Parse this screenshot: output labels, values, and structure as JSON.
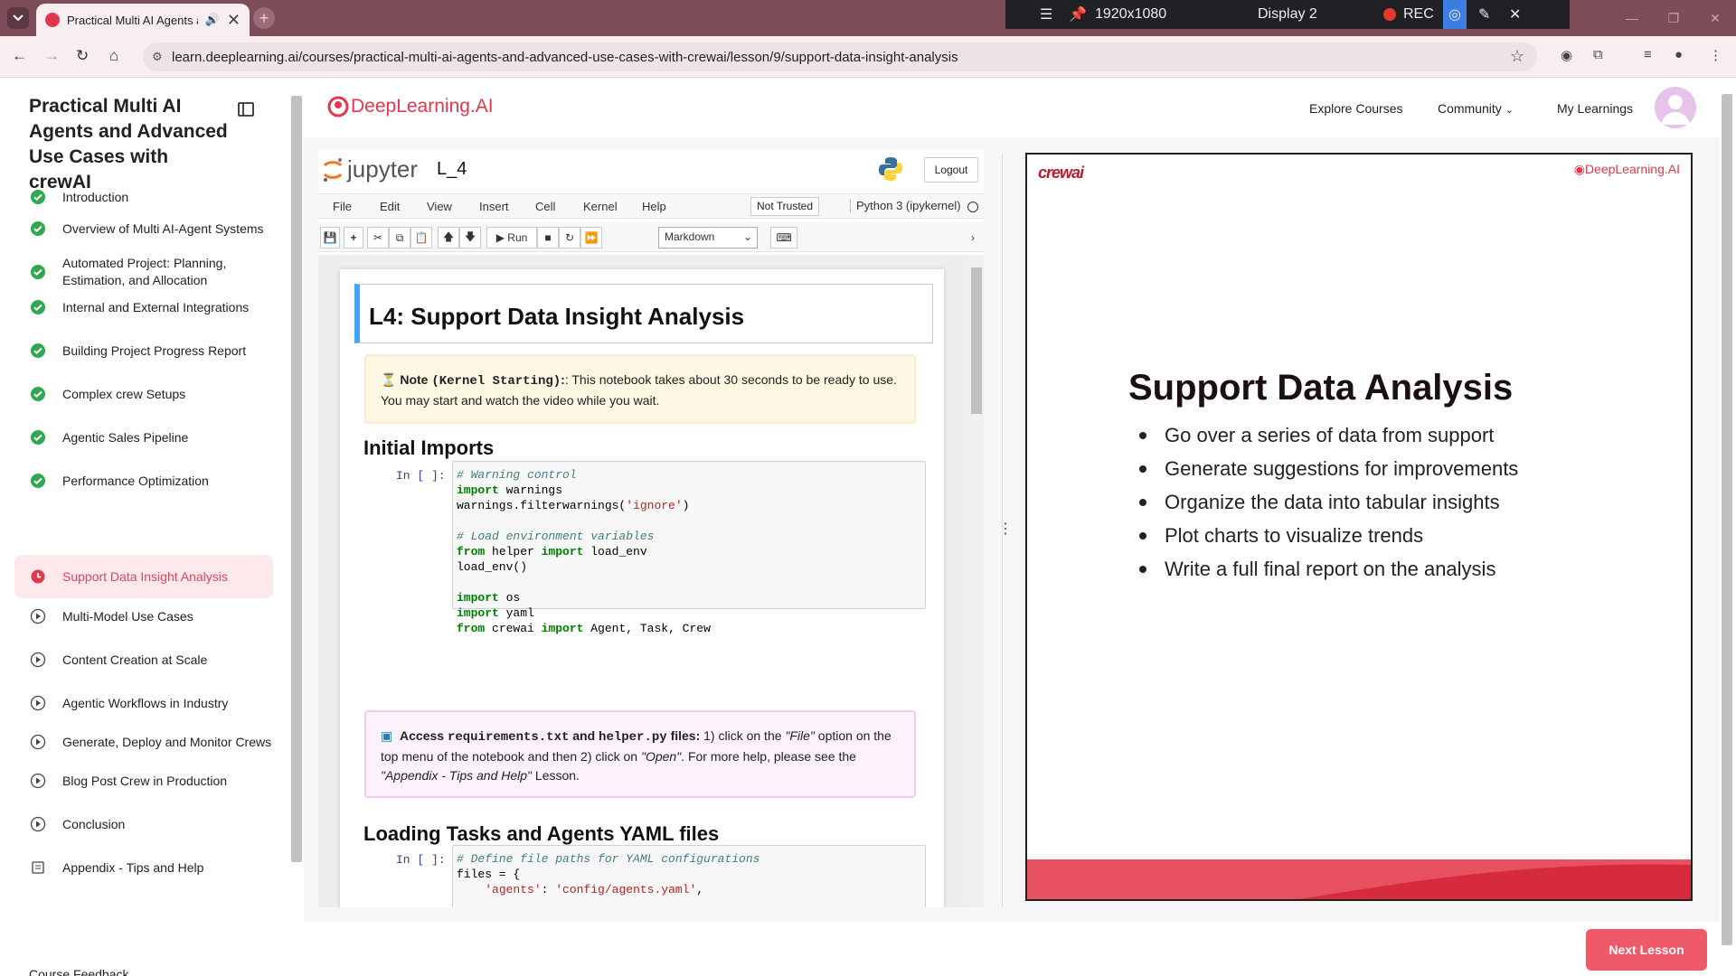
{
  "browser": {
    "tab_title": "Practical Multi AI Agents and Advanced Use Cases with crewAI",
    "url": "learn.deeplearning.ai/courses/practical-multi-ai-agents-and-advanced-use-cases-with-crewai/lesson/9/support-data-insight-analysis"
  },
  "recorder": {
    "resolution": "1920x1080",
    "display": "Display 2",
    "rec_label": "REC"
  },
  "sidebar": {
    "course_title": "Practical Multi AI Agents and Advanced Use Cases with crewAI",
    "lessons": [
      {
        "label": "Introduction",
        "status": "done"
      },
      {
        "label": "Overview of Multi AI-Agent Systems",
        "status": "done"
      },
      {
        "label": "Automated Project: Planning, Estimation, and Allocation",
        "status": "done"
      },
      {
        "label": "Internal and External Integrations",
        "status": "done"
      },
      {
        "label": "Building Project Progress Report",
        "status": "done"
      },
      {
        "label": "Complex crew Setups",
        "status": "done"
      },
      {
        "label": "Agentic Sales Pipeline",
        "status": "done"
      },
      {
        "label": "Performance Optimization",
        "status": "done"
      },
      {
        "label": "Support Data Insight Analysis",
        "status": "active"
      },
      {
        "label": "Multi-Model Use Cases",
        "status": "todo"
      },
      {
        "label": "Content Creation at Scale",
        "status": "todo"
      },
      {
        "label": "Agentic Workflows in Industry",
        "status": "todo"
      },
      {
        "label": "Generate, Deploy and Monitor Crews",
        "status": "todo"
      },
      {
        "label": "Blog Post Crew in Production",
        "status": "todo"
      },
      {
        "label": "Conclusion",
        "status": "todo"
      },
      {
        "label": "Appendix - Tips and Help",
        "status": "reading"
      }
    ],
    "feedback": "Course Feedback"
  },
  "topnav": {
    "logo": "DeepLearning.AI",
    "explore": "Explore Courses",
    "community": "Community",
    "my_learnings": "My Learnings"
  },
  "jupyter": {
    "brand": "jupyter",
    "notebook_name": "L_4",
    "logout": "Logout",
    "menu": [
      "File",
      "Edit",
      "View",
      "Insert",
      "Cell",
      "Kernel",
      "Help"
    ],
    "trusted": "Not Trusted",
    "kernel": "Python 3 (ipykernel)",
    "run": "Run",
    "cell_type": "Markdown",
    "h1": "L4: Support Data Insight Analysis",
    "note": {
      "icon": "⏳",
      "bold": "Note",
      "mono": "(Kernel Starting)",
      "text1": ": This notebook takes about 30 seconds to be ready to use. You may start and watch the video while you wait."
    },
    "h2_imports": "Initial Imports",
    "prompt": "In [ ]:",
    "code1": [
      "# Warning control",
      "import warnings",
      "warnings.filterwarnings('ignore')",
      "",
      "# Load environment variables",
      "from helper import load_env",
      "load_env()",
      "",
      "import os",
      "import yaml",
      "from crewai import Agent, Task, Crew"
    ],
    "access": {
      "lead": "Access",
      "file1": "requirements.txt",
      "and": "and",
      "file2": "helper.py",
      "files": "files:",
      "t1": " 1) click on the ",
      "file_opt": "\"File\"",
      "t2": " option on the top menu of the notebook and then 2) click on ",
      "open": "\"Open\"",
      "t3": ". For more help, please see the ",
      "appendix": "\"Appendix - Tips and Help\"",
      "t4": " Lesson."
    },
    "h2_yaml": "Loading Tasks and Agents YAML files",
    "code2": [
      "# Define file paths for YAML configurations",
      "files = {",
      "    'agents': 'config/agents.yaml',"
    ]
  },
  "slide": {
    "crew_logo": "crewai",
    "dl_logo": "DeepLearning.AI",
    "title": "Support Data Analysis",
    "bullets": [
      "Go over a series of data from support",
      "Generate suggestions for improvements",
      "Organize the data into tabular insights",
      "Plot charts to visualize trends",
      "Write a full final report on the analysis"
    ]
  },
  "footer": {
    "next_lesson": "Next Lesson"
  },
  "colors": {
    "brand": "#e2384d",
    "done": "#2fa84f",
    "active_bg": "#fde8eb",
    "next_btn": "#ef5a6a",
    "chrome": "#7d4d5a"
  }
}
